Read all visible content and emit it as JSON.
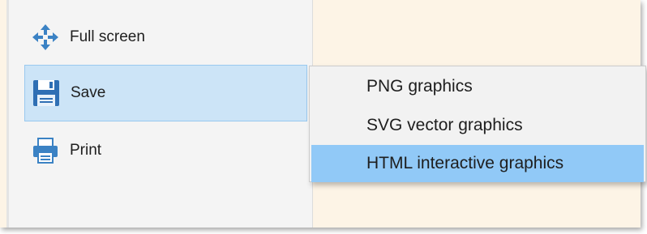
{
  "menu": {
    "items": [
      {
        "label": "Full screen",
        "icon": "move-arrows-icon"
      },
      {
        "label": "Save",
        "icon": "floppy-disk-icon"
      },
      {
        "label": "Print",
        "icon": "printer-icon"
      }
    ]
  },
  "save_submenu": {
    "items": [
      {
        "label": "PNG graphics"
      },
      {
        "label": "SVG vector graphics"
      },
      {
        "label": "HTML interactive graphics"
      }
    ]
  },
  "colors": {
    "highlight": "#91c9f7",
    "selected_item": "#cce4f7",
    "icon_blue": "#3b82c4"
  }
}
